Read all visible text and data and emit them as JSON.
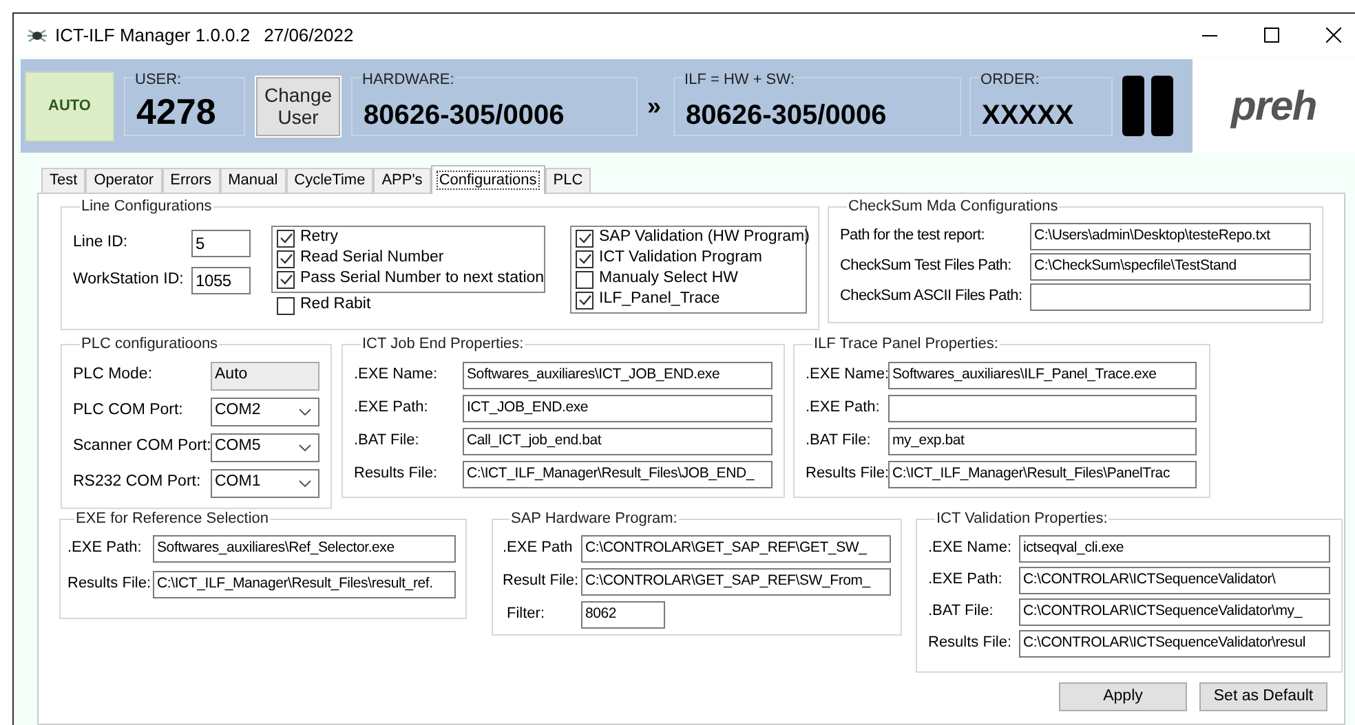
{
  "window": {
    "title": "ICT-ILF Manager 1.0.0.2",
    "date": "27/06/2022"
  },
  "header": {
    "mode": "AUTO",
    "panels": [
      {
        "kind": "user",
        "label": "USER:",
        "value": "4278"
      },
      {
        "kind": "button",
        "label": "Change User"
      },
      {
        "kind": "hardware",
        "label": "HARDWARE:",
        "value": "80626-305/0006"
      },
      {
        "kind": "arrow",
        "label": "»"
      },
      {
        "kind": "ilf",
        "label": "ILF = HW + SW:",
        "value": "80626-305/0006"
      },
      {
        "kind": "order",
        "label": "ORDER:",
        "value": "XXXXX"
      }
    ],
    "logo": "preh"
  },
  "tabs": [
    {
      "label": "Test",
      "selected": false
    },
    {
      "label": "Operator",
      "selected": false
    },
    {
      "label": "Errors",
      "selected": false
    },
    {
      "label": "Manual",
      "selected": false
    },
    {
      "label": "CycleTime",
      "selected": false
    },
    {
      "label": "APP's",
      "selected": false
    },
    {
      "label": "Configurations",
      "selected": true
    },
    {
      "label": "PLC",
      "selected": false
    }
  ],
  "line_configurations": {
    "title": "Line Configurations",
    "fields": [
      {
        "label": "Line ID:",
        "value": "5"
      },
      {
        "label": "WorkStation ID:",
        "value": "1055"
      }
    ],
    "options": [
      {
        "label": "Retry",
        "checked": true
      },
      {
        "label": "Read Serial Number",
        "checked": true
      },
      {
        "label": "Pass Serial Number to next station",
        "checked": true
      }
    ],
    "extra_option": {
      "label": "Red Rabit",
      "checked": false
    },
    "validations": [
      {
        "label": "SAP Validation (HW Program)",
        "checked": true
      },
      {
        "label": "ICT Validation Program",
        "checked": true
      },
      {
        "label": "Manualy Select HW",
        "checked": false
      },
      {
        "label": "ILF_Panel_Trace",
        "checked": true
      }
    ]
  },
  "checksum": {
    "title": "CheckSum Mda Configurations",
    "fields": [
      {
        "label": "Path for the test report:",
        "value": "C:\\Users\\admin\\Desktop\\testeRepo.txt"
      },
      {
        "label": "CheckSum Test Files Path:",
        "value": "C:\\CheckSum\\specfile\\TestStand"
      },
      {
        "label": "CheckSum ASCII Files Path:"
      }
    ]
  },
  "plc": {
    "title": "PLC configuratioons",
    "fields": [
      {
        "kind": "readonly",
        "label": "PLC Mode:",
        "value": "Auto"
      },
      {
        "kind": "dropdown",
        "label": "PLC COM Port:",
        "value": "COM2"
      },
      {
        "kind": "dropdown",
        "label": "Scanner COM Port:",
        "value": "COM5"
      },
      {
        "kind": "dropdown",
        "label": "RS232 COM Port:",
        "value": "COM1"
      }
    ]
  },
  "ict_job_end": {
    "title": "ICT Job End Properties:",
    "fields": [
      {
        "label": ".EXE Name:",
        "value": "Softwares_auxiliares\\ICT_JOB_END.exe"
      },
      {
        "label": ".EXE Path:",
        "value": "ICT_JOB_END.exe"
      },
      {
        "label": ".BAT File:",
        "value": "Call_ICT_job_end.bat"
      },
      {
        "label": "Results File:",
        "value": "C:\\ICT_ILF_Manager\\Result_Files\\JOB_END_"
      }
    ]
  },
  "ilf_trace": {
    "title": "ILF Trace Panel Properties:",
    "fields": [
      {
        "label": ".EXE Name:",
        "value": "Softwares_auxiliares\\ILF_Panel_Trace.exe"
      },
      {
        "label": ".EXE Path:"
      },
      {
        "label": ".BAT File:",
        "value": "my_exp.bat"
      },
      {
        "label": "Results File:",
        "value": "C:\\ICT_ILF_Manager\\Result_Files\\PanelTrac"
      }
    ]
  },
  "ref_selection": {
    "title": "EXE for Reference Selection",
    "fields": [
      {
        "label": ".EXE Path:",
        "value": "Softwares_auxiliares\\Ref_Selector.exe"
      },
      {
        "label": "Results File:",
        "value": "C:\\ICT_ILF_Manager\\Result_Files\\result_ref."
      }
    ]
  },
  "sap_hardware": {
    "title": "SAP Hardware Program:",
    "fields": [
      {
        "label": ".EXE Path",
        "value": "C:\\CONTROLAR\\GET_SAP_REF\\GET_SW_"
      },
      {
        "label": "Result File:",
        "value": "C:\\CONTROLAR\\GET_SAP_REF\\SW_From_"
      },
      {
        "label": "Filter:",
        "value": "8062"
      }
    ]
  },
  "ict_validation": {
    "title": "ICT Validation Properties:",
    "fields": [
      {
        "label": ".EXE Name:",
        "value": "ictseqval_cli.exe"
      },
      {
        "label": ".EXE Path:",
        "value": "C:\\CONTROLAR\\ICTSequenceValidator\\"
      },
      {
        "label": ".BAT File:",
        "value": "C:\\CONTROLAR\\ICTSequenceValidator\\my_"
      },
      {
        "label": "Results File:",
        "value": "C:\\CONTROLAR\\ICTSequenceValidator\\resul"
      }
    ]
  },
  "buttons": [
    "Apply",
    "Set as Default"
  ]
}
